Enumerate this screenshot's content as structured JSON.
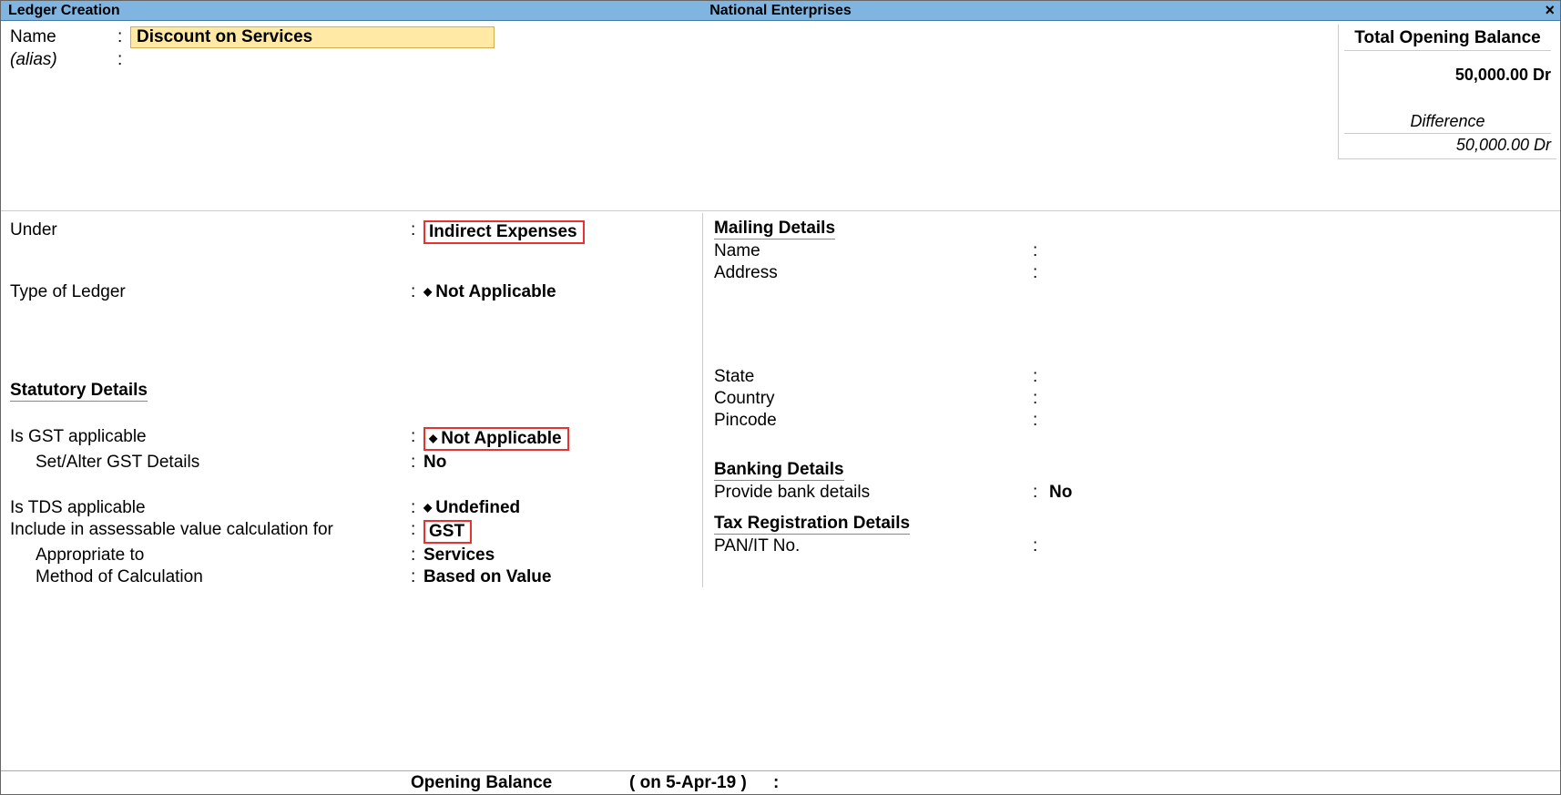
{
  "titlebar": {
    "left": "Ledger Creation",
    "center": "National Enterprises",
    "close": "×"
  },
  "name_block": {
    "name_label": "Name",
    "name_value": "Discount on Services",
    "alias_label": "(alias)"
  },
  "balance": {
    "title": "Total Opening Balance",
    "amount": "50,000.00 Dr",
    "diff_label": "Difference",
    "diff_amount": "50,000.00 Dr"
  },
  "left": {
    "under_label": "Under",
    "under_value": "Indirect Expenses",
    "type_label": "Type of Ledger",
    "type_value": "Not Applicable",
    "statutory_heading": "Statutory Details",
    "gst_applicable_label": "Is GST applicable",
    "gst_applicable_value": "Not Applicable",
    "set_alter_gst_label": "Set/Alter GST Details",
    "set_alter_gst_value": "No",
    "tds_label": "Is TDS applicable",
    "tds_value": "Undefined",
    "include_label": "Include in assessable value calculation for",
    "include_value": "GST",
    "appropriate_label": "Appropriate to",
    "appropriate_value": "Services",
    "method_label": "Method of Calculation",
    "method_value": "Based on Value"
  },
  "right": {
    "mailing_heading": "Mailing Details",
    "mail_name_label": "Name",
    "mail_address_label": "Address",
    "state_label": "State",
    "country_label": "Country",
    "pincode_label": "Pincode",
    "banking_heading": "Banking Details",
    "bank_label": "Provide bank details",
    "bank_value": "No",
    "tax_heading": "Tax Registration Details",
    "pan_label": "PAN/IT No."
  },
  "footer": {
    "label": "Opening Balance",
    "date": "( on 5-Apr-19 )",
    "colon": ":"
  }
}
